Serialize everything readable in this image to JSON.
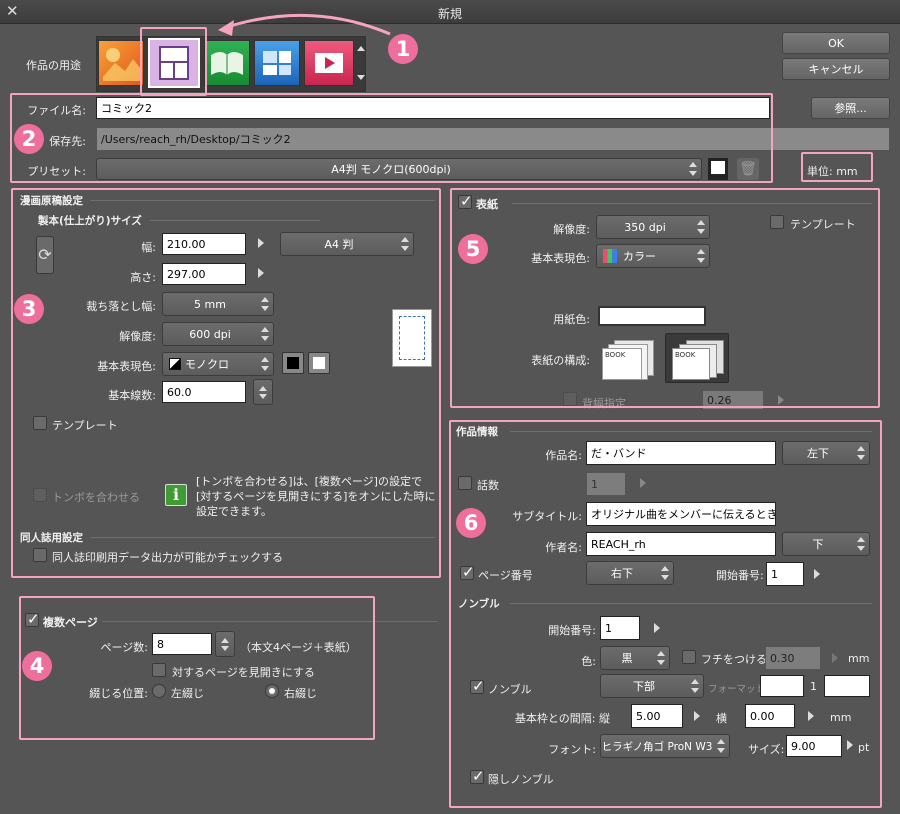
{
  "window": {
    "title": "新規"
  },
  "buttons": {
    "ok": "OK",
    "cancel": "キャンセル",
    "browse": "参照..."
  },
  "usage": {
    "label": "作品の用途"
  },
  "file": {
    "name_label": "ファイル名:",
    "name_value": "コミック2",
    "dest_label": "保存先:",
    "dest_value": "/Users/reach_rh/Desktop/コミック2",
    "preset_label": "プリセット:",
    "preset_value": "A4判 モノクロ(600dpi)",
    "unit_label": "単位:",
    "unit_value": "mm"
  },
  "manga": {
    "section": "漫画原稿設定",
    "subsection": "製本(仕上がり)サイズ",
    "width_label": "幅:",
    "width_value": "210.00",
    "size_preset": "A4 判",
    "height_label": "高さ:",
    "height_value": "297.00",
    "bleed_label": "裁ち落とし幅:",
    "bleed_value": "5 mm",
    "res_label": "解像度:",
    "res_value": "600 dpi",
    "color_label": "基本表現色:",
    "color_value": "モノクロ",
    "lines_label": "基本線数:",
    "lines_value": "60.0",
    "template_label": "テンプレート",
    "tombo_label": "トンボを合わせる",
    "info_line1": "[トンボを合わせる]は、[複数ページ]の設定で",
    "info_line2": "[対するページを見開きにする]をオンにした時に",
    "info_line3": "設定できます。"
  },
  "doujin": {
    "section": "同人誌用設定",
    "check_label": "同人誌印刷用データ出力が可能かチェックする"
  },
  "multi": {
    "label": "複数ページ",
    "pages_label": "ページ数:",
    "pages_value": "8",
    "pages_note": "（本文4ページ＋表紙）",
    "spread_label": "対するページを見開きにする",
    "bind_label": "綴じる位置:",
    "left_bind": "左綴じ",
    "right_bind": "右綴じ"
  },
  "cover": {
    "label": "表紙",
    "res_label": "解像度:",
    "res_value": "350 dpi",
    "template_label": "テンプレート",
    "color_label": "基本表現色:",
    "color_value": "カラー",
    "paper_label": "用紙色:",
    "layout_label": "表紙の構成:",
    "book_text": "BOOK",
    "spine_label": "背幅指定",
    "spine_value": "0.26"
  },
  "work": {
    "section": "作品情報",
    "title_label": "作品名:",
    "title_value": "だ・バンド",
    "title_pos": "左下",
    "episode_label": "話数",
    "episode_value": "1",
    "subtitle_label": "サブタイトル:",
    "subtitle_value": "オリジナル曲をメンバーに伝えるとき",
    "author_label": "作者名:",
    "author_value": "REACH_rh",
    "author_pos": "下",
    "pagenum_label": "ページ番号",
    "pagenum_pos": "右下",
    "start_label": "開始番号:",
    "start_value": "1"
  },
  "nombre": {
    "section": "ノンブル",
    "start_label": "開始番号:",
    "start_value": "1",
    "color_label": "色:",
    "color_value": "黒",
    "border_label": "フチをつける",
    "border_value": "0.30",
    "unit": "mm",
    "nombre_label": "ノンブル",
    "pos_value": "下部",
    "format_label": "フォーマット",
    "format_mid": "1",
    "gap_label": "基本枠との間隔: 縦",
    "gap_v": "5.00",
    "gap_h_label": "横",
    "gap_h": "0.00",
    "font_label": "フォント:",
    "font_value": "ヒラギノ角ゴ ProN W3",
    "size_label": "サイズ:",
    "size_value": "9.00",
    "size_unit": "pt",
    "hidden_label": "隠しノンブル"
  },
  "badges": [
    "1",
    "2",
    "3",
    "4",
    "5",
    "6"
  ]
}
